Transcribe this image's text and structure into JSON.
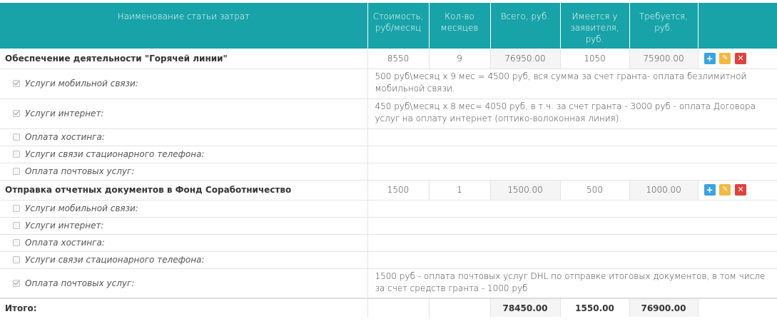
{
  "header": {
    "name": "Наименование статьи затрат",
    "cost": "Стоимость, руб/месяц",
    "months": "Кол-во месяцев",
    "total": "Всего, руб.",
    "has": "Имеется у заявителя, руб.",
    "need": "Требуется, руб."
  },
  "groups": [
    {
      "name": "Обеспечение деятельности \"Горячей линии\"",
      "cost": "8550",
      "months": "9",
      "total": "76950.00",
      "has": "1050",
      "need": "75900.00",
      "items": [
        {
          "label": "Услуги мобильной связи:",
          "checked": true,
          "desc": "500 руб\\месяц х 9 мес = 4500 руб, вся сумма за счет гранта- оплата безлимитной мобильной связи."
        },
        {
          "label": "Услуги интернет:",
          "checked": true,
          "desc": "450 руб\\месяц х 8 мес= 4050 руб, в т.ч. за счет гранта - 3000 руб - оплата Договора услуг на оплату интернет (оптико-волоконная линия)."
        },
        {
          "label": "Оплата хостинга:",
          "checked": false,
          "desc": ""
        },
        {
          "label": "Услуги связи стационарного телефона:",
          "checked": false,
          "desc": ""
        },
        {
          "label": "Оплата почтовых услуг:",
          "checked": false,
          "desc": ""
        }
      ]
    },
    {
      "name": "Отправка отчетных документов в Фонд Соработничество",
      "cost": "1500",
      "months": "1",
      "total": "1500.00",
      "has": "500",
      "need": "1000.00",
      "items": [
        {
          "label": "Услуги мобильной связи:",
          "checked": false,
          "desc": ""
        },
        {
          "label": "Услуги интернет:",
          "checked": false,
          "desc": ""
        },
        {
          "label": "Оплата хостинга:",
          "checked": false,
          "desc": ""
        },
        {
          "label": "Услуги связи стационарного телефона:",
          "checked": false,
          "desc": ""
        },
        {
          "label": "Оплата почтовых услуг:",
          "checked": true,
          "desc": "1500 руб - оплата почтовых услуг DHL по отправке итоговых документов, в том числе за счет средств гранта - 1000 руб"
        }
      ]
    }
  ],
  "totals": {
    "label": "Итого:",
    "total": "78450.00",
    "has": "1550.00",
    "need": "76900.00"
  },
  "actions": {
    "add_icon": "+",
    "edit_icon": "✎",
    "delete_icon": "✕"
  },
  "colors": {
    "header_bg": "#17a3a8",
    "add": "#3aa3e3",
    "edit": "#f3b940",
    "delete": "#e2403c"
  }
}
